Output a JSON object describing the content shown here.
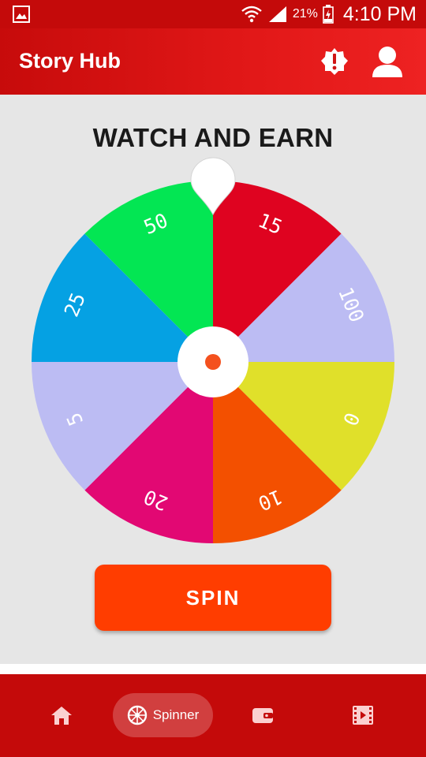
{
  "status_bar": {
    "battery": "21%",
    "time": "4:10 PM"
  },
  "app_bar": {
    "title": "Story Hub",
    "icons": [
      "alert-badge-icon",
      "account-icon"
    ]
  },
  "main": {
    "heading": "WATCH AND EARN",
    "spin_label": "SPIN"
  },
  "wheel": {
    "segments": [
      {
        "label": "15",
        "color": "#df0320"
      },
      {
        "label": "100",
        "color": "#bcbcf3"
      },
      {
        "label": "0",
        "color": "#e0e02a"
      },
      {
        "label": "10",
        "color": "#f35000"
      },
      {
        "label": "20",
        "color": "#e20873"
      },
      {
        "label": "5",
        "color": "#bcbcf3"
      },
      {
        "label": "25",
        "color": "#05a1e3"
      },
      {
        "label": "50",
        "color": "#03e653"
      }
    ],
    "hub_dot_color": "#f4511e"
  },
  "bottom_nav": {
    "active_label": "Spinner",
    "items": [
      "home-icon",
      "spinner-icon",
      "wallet-icon",
      "videos-icon"
    ]
  },
  "colors": {
    "primary": "#c40a0a",
    "spin_button": "#ff3d00",
    "background": "#e6e6e6"
  }
}
